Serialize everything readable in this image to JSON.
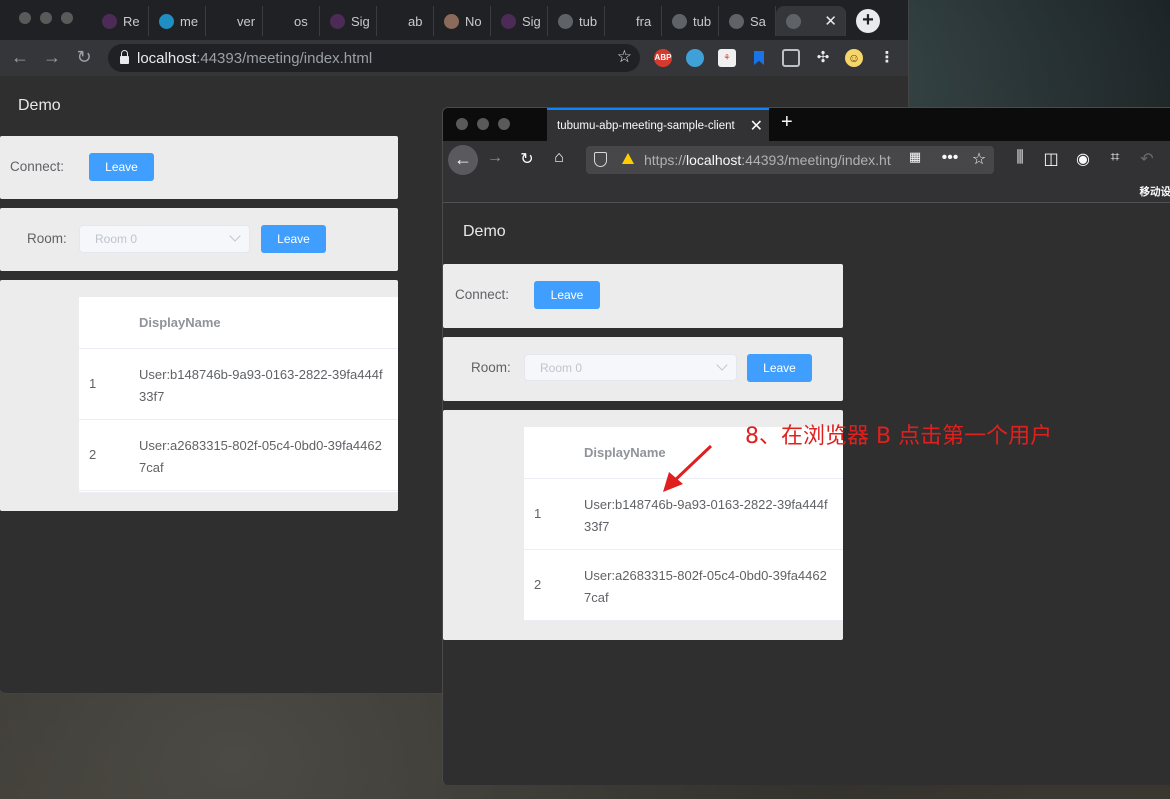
{
  "window_a": {
    "tabs": [
      {
        "label": "Re",
        "icon": "podcast-icon",
        "color": "#4c2b57"
      },
      {
        "label": "me",
        "icon": "meeting-icon",
        "color": "#1f8ec2"
      },
      {
        "label": "ver",
        "icon": "github-icon",
        "color": "#202124"
      },
      {
        "label": "os",
        "icon": "github-icon",
        "color": "#202124"
      },
      {
        "label": "Sig",
        "icon": "podcast-icon",
        "color": "#4c2b57"
      },
      {
        "label": "ab",
        "icon": "github-icon",
        "color": "#202124"
      },
      {
        "label": "No",
        "icon": "cat-icon",
        "color": "#8a6a5a"
      },
      {
        "label": "Sig",
        "icon": "podcast-icon",
        "color": "#4c2b57"
      },
      {
        "label": "tub",
        "icon": "globe-icon",
        "color": "#5f6368"
      },
      {
        "label": "fra",
        "icon": "github-icon",
        "color": "#202124"
      },
      {
        "label": "tub",
        "icon": "globe-icon",
        "color": "#5f6368"
      },
      {
        "label": "Sa",
        "icon": "globe-icon",
        "color": "#5f6368"
      }
    ],
    "address": {
      "host": "localhost",
      "path": ":44393/meeting/index.html"
    },
    "page": {
      "title": "Demo",
      "connect_label": "Connect:",
      "connect_button": "Leave",
      "room_label": "Room:",
      "room_placeholder": "Room 0",
      "room_button": "Leave",
      "table_header": "DisplayName",
      "rows": [
        {
          "index": "1",
          "name": "User:b148746b-9a93-0163-2822-39fa444f33f7"
        },
        {
          "index": "2",
          "name": "User:a2683315-802f-05c4-0bd0-39fa44627caf"
        }
      ]
    },
    "extensions": {
      "abp": "ABP"
    }
  },
  "window_b": {
    "tab_title": "tubumu-abp-meeting-sample-client",
    "address": {
      "scheme": "https://",
      "host": "localhost",
      "path": ":44393/meeting/index.ht"
    },
    "ime_label": "移动设",
    "page": {
      "title": "Demo",
      "connect_label": "Connect:",
      "connect_button": "Leave",
      "room_label": "Room:",
      "room_placeholder": "Room 0",
      "room_button": "Leave",
      "table_header": "DisplayName",
      "rows": [
        {
          "index": "1",
          "name": "User:b148746b-9a93-0163-2822-39fa444f33f7"
        },
        {
          "index": "2",
          "name": "User:a2683315-802f-05c4-0bd0-39fa44627caf"
        }
      ]
    }
  },
  "annotation": {
    "text": "8、在浏览器 B 点击第一个用户",
    "color": "#e0201e"
  }
}
